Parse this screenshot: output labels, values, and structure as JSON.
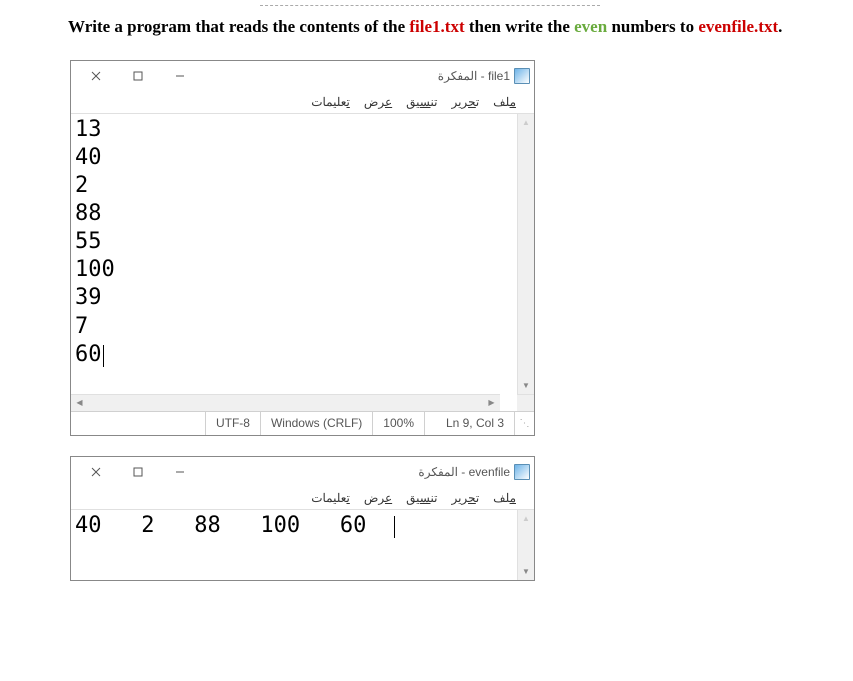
{
  "instruction": {
    "part1": "Write a program that reads the contents of the ",
    "file1": "file1.txt",
    "part2": " then write the ",
    "even": "even",
    "part3": " numbers to ",
    "evenfile": "evenfile.txt",
    "part4": "."
  },
  "window1": {
    "title": "file1 - المفكرة",
    "menu": {
      "file": "ملف",
      "edit": "تحرير",
      "format": "تنسيق",
      "view": "عرض",
      "help": "تعليمات"
    },
    "content_lines": [
      "13",
      "40",
      "2",
      "88",
      "55",
      "100",
      "39",
      "7",
      "60"
    ],
    "statusbar": {
      "coord": "Ln 9, Col 3",
      "zoom": "100%",
      "crlf": "Windows (CRLF)",
      "enc": "UTF-8"
    }
  },
  "window2": {
    "title": "evenfile - المفكرة",
    "menu": {
      "file": "ملف",
      "edit": "تحرير",
      "format": "تنسيق",
      "view": "عرض",
      "help": "تعليمات"
    },
    "content": "40   2   88   100   60  "
  }
}
